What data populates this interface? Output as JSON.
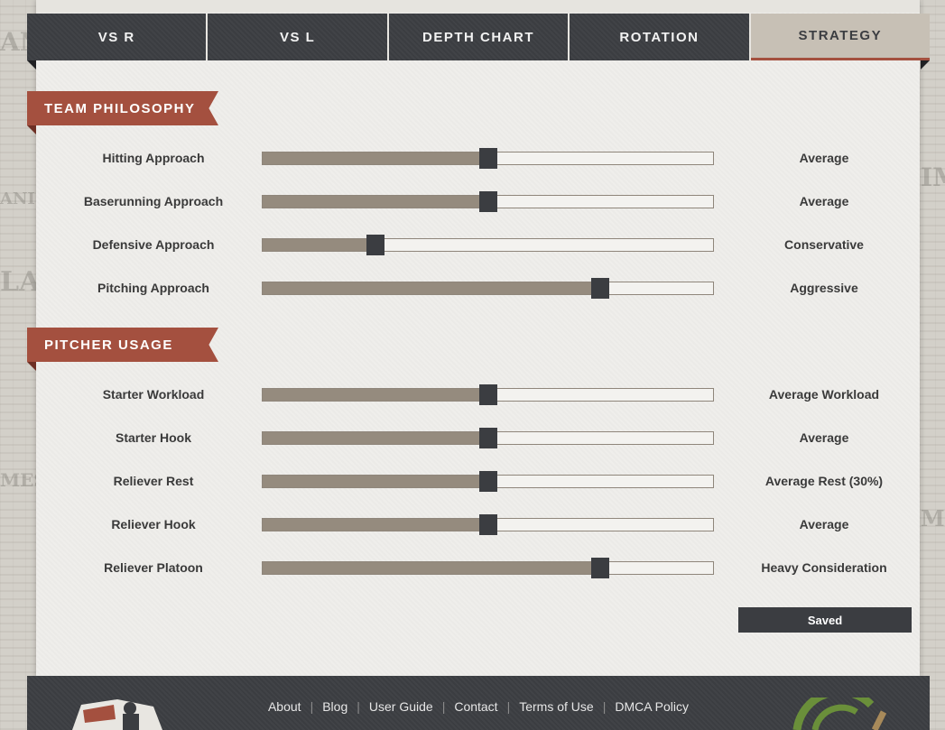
{
  "tabs": [
    {
      "label": "VS R",
      "active": false
    },
    {
      "label": "VS L",
      "active": false
    },
    {
      "label": "DEPTH CHART",
      "active": false
    },
    {
      "label": "ROTATION",
      "active": false
    },
    {
      "label": "STRATEGY",
      "active": true
    }
  ],
  "sections": {
    "team_philosophy": {
      "title": "TEAM PHILOSOPHY",
      "rows": [
        {
          "label": "Hitting Approach",
          "value": "Average",
          "level": 0.5
        },
        {
          "label": "Baserunning Approach",
          "value": "Average",
          "level": 0.5
        },
        {
          "label": "Defensive Approach",
          "value": "Conservative",
          "level": 0.25
        },
        {
          "label": "Pitching Approach",
          "value": "Aggressive",
          "level": 0.75
        }
      ]
    },
    "pitcher_usage": {
      "title": "PITCHER USAGE",
      "rows": [
        {
          "label": "Starter Workload",
          "value": "Average Workload",
          "level": 0.5
        },
        {
          "label": "Starter Hook",
          "value": "Average",
          "level": 0.5
        },
        {
          "label": "Reliever Rest",
          "value": "Average Rest (30%)",
          "level": 0.5
        },
        {
          "label": "Reliever Hook",
          "value": "Average",
          "level": 0.5
        },
        {
          "label": "Reliever Platoon",
          "value": "Heavy Consideration",
          "level": 0.75
        }
      ]
    }
  },
  "save_button": {
    "label": "Saved"
  },
  "footer": {
    "links": [
      "About",
      "Blog",
      "User Guide",
      "Contact",
      "Terms of Use",
      "DMCA Policy"
    ]
  },
  "colors": {
    "accent": "#a4503f",
    "dark": "#3b3d41",
    "slider_fill": "#958b7e",
    "active_tab": "#c7c0b5"
  },
  "icons": {
    "footer_left_logo": "team-logo-icon",
    "footer_right_logo": "partner-logo-icon"
  }
}
